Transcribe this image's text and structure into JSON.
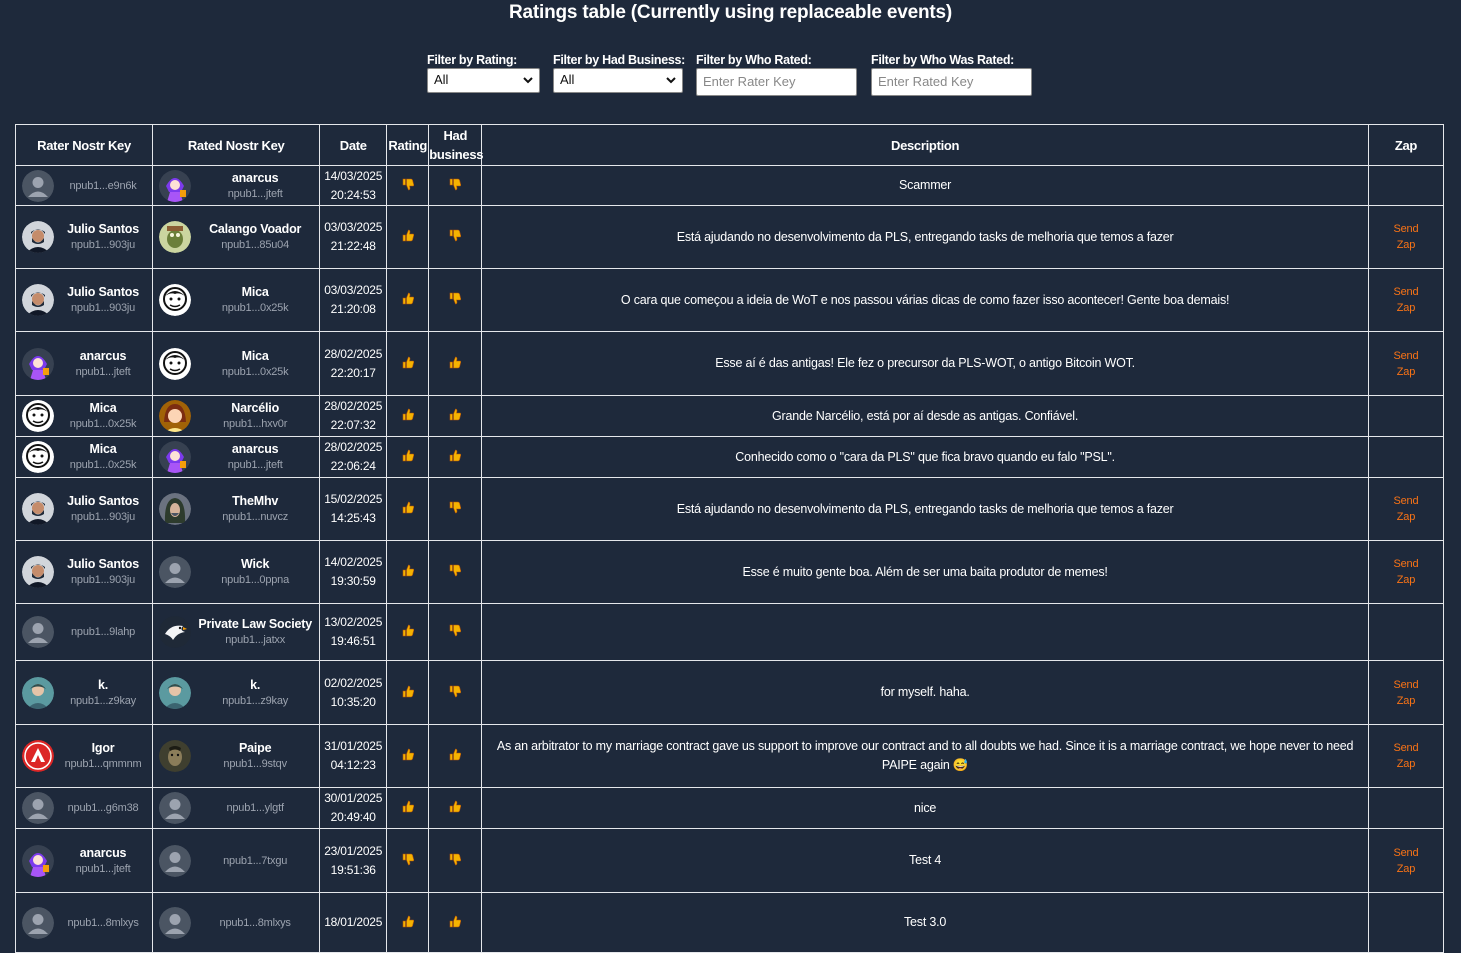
{
  "title": "Ratings table (Currently using replaceable events)",
  "filters": {
    "rating": {
      "label": "Filter by Rating:",
      "value": "All"
    },
    "business": {
      "label": "Filter by Had Business:",
      "value": "All"
    },
    "rater": {
      "label": "Filter by Who Rated:",
      "placeholder": "Enter Rater Key"
    },
    "rated": {
      "label": "Filter by Who Was Rated:",
      "placeholder": "Enter Rated Key"
    }
  },
  "headers": [
    "Rater Nostr Key",
    "Rated Nostr Key",
    "Date",
    "Rating",
    "Had business",
    "Description",
    "Zap"
  ],
  "zap_label_1": "Send",
  "zap_label_2": "Zap",
  "colors": {
    "background": "#1e293b",
    "zap": "#f97316",
    "thumb": "#f5b301"
  },
  "rows": [
    {
      "rater": {
        "name": "",
        "npub": "npub1...e9n6k",
        "avatar": "default-avatar"
      },
      "rated": {
        "name": "anarcus",
        "npub": "npub1...jteft",
        "avatar": "anime-avatar"
      },
      "date": "14/03/2025",
      "time": "20:24:53",
      "rating": "down",
      "business": "down",
      "description": "Scammer",
      "zap": false
    },
    {
      "rater": {
        "name": "Julio Santos",
        "npub": "npub1...903ju",
        "avatar": "man-avatar"
      },
      "rated": {
        "name": "Calango Voador",
        "npub": "npub1...85u04",
        "avatar": "lizard-avatar"
      },
      "date": "03/03/2025",
      "time": "21:22:48",
      "rating": "up",
      "business": "down",
      "description": "Está ajudando no desenvolvimento da PLS, entregando tasks de melhoria que temos a fazer",
      "zap": true
    },
    {
      "rater": {
        "name": "Julio Santos",
        "npub": "npub1...903ju",
        "avatar": "man-avatar"
      },
      "rated": {
        "name": "Mica",
        "npub": "npub1...0x25k",
        "avatar": "mica-avatar"
      },
      "date": "03/03/2025",
      "time": "21:20:08",
      "rating": "up",
      "business": "down",
      "description": "O cara que começou a ideia de WoT e nos passou várias dicas de como fazer isso acontecer! Gente boa demais!",
      "zap": true
    },
    {
      "rater": {
        "name": "anarcus",
        "npub": "npub1...jteft",
        "avatar": "anime-avatar"
      },
      "rated": {
        "name": "Mica",
        "npub": "npub1...0x25k",
        "avatar": "mica-avatar"
      },
      "date": "28/02/2025",
      "time": "22:20:17",
      "rating": "up",
      "business": "up",
      "description": "Esse aí é das antigas! Ele fez o precursor da PLS-WOT, o antigo Bitcoin WOT.",
      "zap": true
    },
    {
      "rater": {
        "name": "Mica",
        "npub": "npub1...0x25k",
        "avatar": "mica-avatar"
      },
      "rated": {
        "name": "Narcélio",
        "npub": "npub1...hxv0r",
        "avatar": "woman-avatar"
      },
      "date": "28/02/2025",
      "time": "22:07:32",
      "rating": "up",
      "business": "up",
      "description": "Grande Narcélio, está por aí desde as antigas. Confiável.",
      "zap": false
    },
    {
      "rater": {
        "name": "Mica",
        "npub": "npub1...0x25k",
        "avatar": "mica-avatar"
      },
      "rated": {
        "name": "anarcus",
        "npub": "npub1...jteft",
        "avatar": "anime-avatar"
      },
      "date": "28/02/2025",
      "time": "22:06:24",
      "rating": "up",
      "business": "up",
      "description": "Conhecido como o \"cara da PLS\" que fica bravo quando eu falo \"PSL\".",
      "zap": false
    },
    {
      "rater": {
        "name": "Julio Santos",
        "npub": "npub1...903ju",
        "avatar": "man-avatar"
      },
      "rated": {
        "name": "TheMhv",
        "npub": "npub1...nuvcz",
        "avatar": "hooded-avatar"
      },
      "date": "15/02/2025",
      "time": "14:25:43",
      "rating": "up",
      "business": "down",
      "description": "Está ajudando no desenvolvimento da PLS, entregando tasks de melhoria que temos a fazer",
      "zap": true
    },
    {
      "rater": {
        "name": "Julio Santos",
        "npub": "npub1...903ju",
        "avatar": "man-avatar"
      },
      "rated": {
        "name": "Wick",
        "npub": "npub1...0ppna",
        "avatar": "default-avatar"
      },
      "date": "14/02/2025",
      "time": "19:30:59",
      "rating": "up",
      "business": "down",
      "description": "Esse é muito gente boa. Além de ser uma baita produtor de memes!",
      "zap": true
    },
    {
      "rater": {
        "name": "",
        "npub": "npub1...9lahp",
        "avatar": "default-avatar"
      },
      "rated": {
        "name": "Private Law Society",
        "npub": "npub1...jatxx",
        "avatar": "eagle-avatar"
      },
      "date": "13/02/2025",
      "time": "19:46:51",
      "rating": "up",
      "business": "down",
      "description": "",
      "zap": false
    },
    {
      "rater": {
        "name": "k.",
        "npub": "npub1...z9kay",
        "avatar": "k-avatar"
      },
      "rated": {
        "name": "k.",
        "npub": "npub1...z9kay",
        "avatar": "k-avatar"
      },
      "date": "02/02/2025",
      "time": "10:35:20",
      "rating": "up",
      "business": "down",
      "description": "for myself. haha.",
      "zap": true
    },
    {
      "rater": {
        "name": "Igor",
        "npub": "npub1...qmmnm",
        "avatar": "red-logo-avatar"
      },
      "rated": {
        "name": "Paipe",
        "npub": "npub1...9stqv",
        "avatar": "paipe-avatar"
      },
      "date": "31/01/2025",
      "time": "04:12:23",
      "rating": "up",
      "business": "up",
      "description": "As an arbitrator to my marriage contract gave us support to improve our contract and to all doubts we had. Since it is a marriage contract, we hope never to need PAIPE again 😅",
      "zap": true
    },
    {
      "rater": {
        "name": "",
        "npub": "npub1...g6m38",
        "avatar": "default-avatar"
      },
      "rated": {
        "name": "",
        "npub": "npub1...ylgtf",
        "avatar": "default-avatar"
      },
      "date": "30/01/2025",
      "time": "20:49:40",
      "rating": "up",
      "business": "up",
      "description": "nice",
      "zap": false
    },
    {
      "rater": {
        "name": "anarcus",
        "npub": "npub1...jteft",
        "avatar": "anime-avatar"
      },
      "rated": {
        "name": "",
        "npub": "npub1...7txgu",
        "avatar": "default-avatar"
      },
      "date": "23/01/2025",
      "time": "19:51:36",
      "rating": "down",
      "business": "down",
      "description": "Test 4",
      "zap": true
    },
    {
      "rater": {
        "name": "",
        "npub": "npub1...8mlxys",
        "avatar": "default-avatar"
      },
      "rated": {
        "name": "",
        "npub": "npub1...8mlxys",
        "avatar": "default-avatar"
      },
      "date": "18/01/2025",
      "time": "",
      "rating": "up",
      "business": "up",
      "description": "Test 3.0",
      "zap": false
    }
  ]
}
